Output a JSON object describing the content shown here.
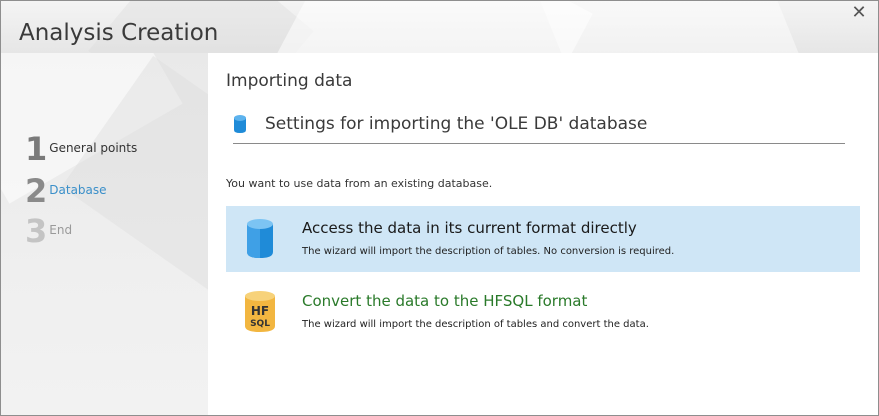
{
  "window": {
    "title": "Analysis Creation",
    "close_label": "✕"
  },
  "steps": [
    {
      "number": "1",
      "label": "General points",
      "state": "done"
    },
    {
      "number": "2",
      "label": "Database",
      "state": "current"
    },
    {
      "number": "3",
      "label": "End",
      "state": "pending"
    }
  ],
  "main": {
    "heading": "Importing data",
    "settings_title": "Settings for importing the 'OLE DB' database",
    "intro": "You want to use data from an existing database.",
    "options": [
      {
        "title": "Access the data in its current format directly",
        "description": "The wizard will import the description of tables. No conversion is required.",
        "icon": "database-icon",
        "selected": true
      },
      {
        "title": "Convert the data to the HFSQL format",
        "description": "The wizard will import the description of tables and convert the data.",
        "icon": "hfsql-database-icon",
        "icon_text_top": "HF",
        "icon_text_bottom": "SQL",
        "selected": false
      }
    ]
  },
  "colors": {
    "selected_option_bg": "#cfe6f6",
    "current_step": "#3a8fc9",
    "option2_title": "#2a7a2a",
    "database_blue": "#1f8bd8",
    "hfsql_gold": "#f2b640"
  }
}
